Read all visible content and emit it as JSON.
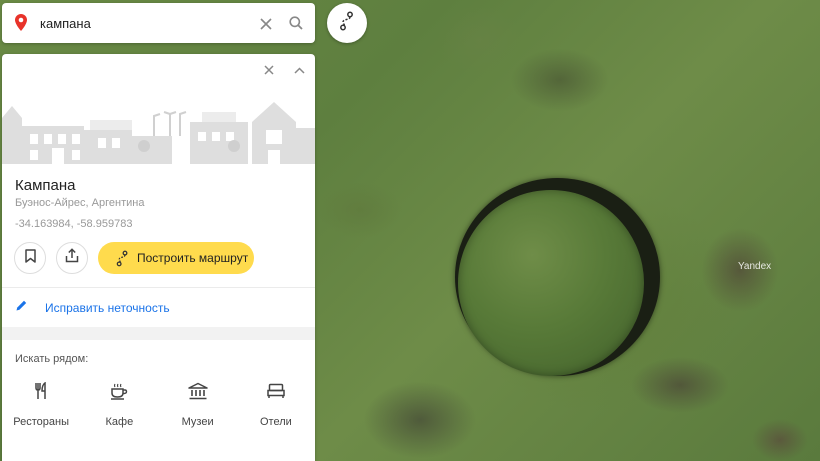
{
  "search": {
    "value": "кампана"
  },
  "place": {
    "title": "Кампана",
    "subtitle": "Буэнос-Айрес, Аргентина",
    "coordinates": "-34.163984, -58.959783"
  },
  "actions": {
    "route_label": "Построить маршрут",
    "fix_label": "Исправить неточность"
  },
  "nearby": {
    "title": "Искать рядом:",
    "items": [
      {
        "label": "Рестораны",
        "icon": "fork-knife-icon"
      },
      {
        "label": "Кафе",
        "icon": "coffee-cup-icon"
      },
      {
        "label": "Музеи",
        "icon": "museum-icon"
      },
      {
        "label": "Отели",
        "icon": "bed-icon"
      }
    ]
  },
  "map": {
    "watermark": "Yandex"
  },
  "colors": {
    "accent_yellow": "#ffdb4d",
    "link_blue": "#1a73e8",
    "pin_red": "#e8332a"
  }
}
